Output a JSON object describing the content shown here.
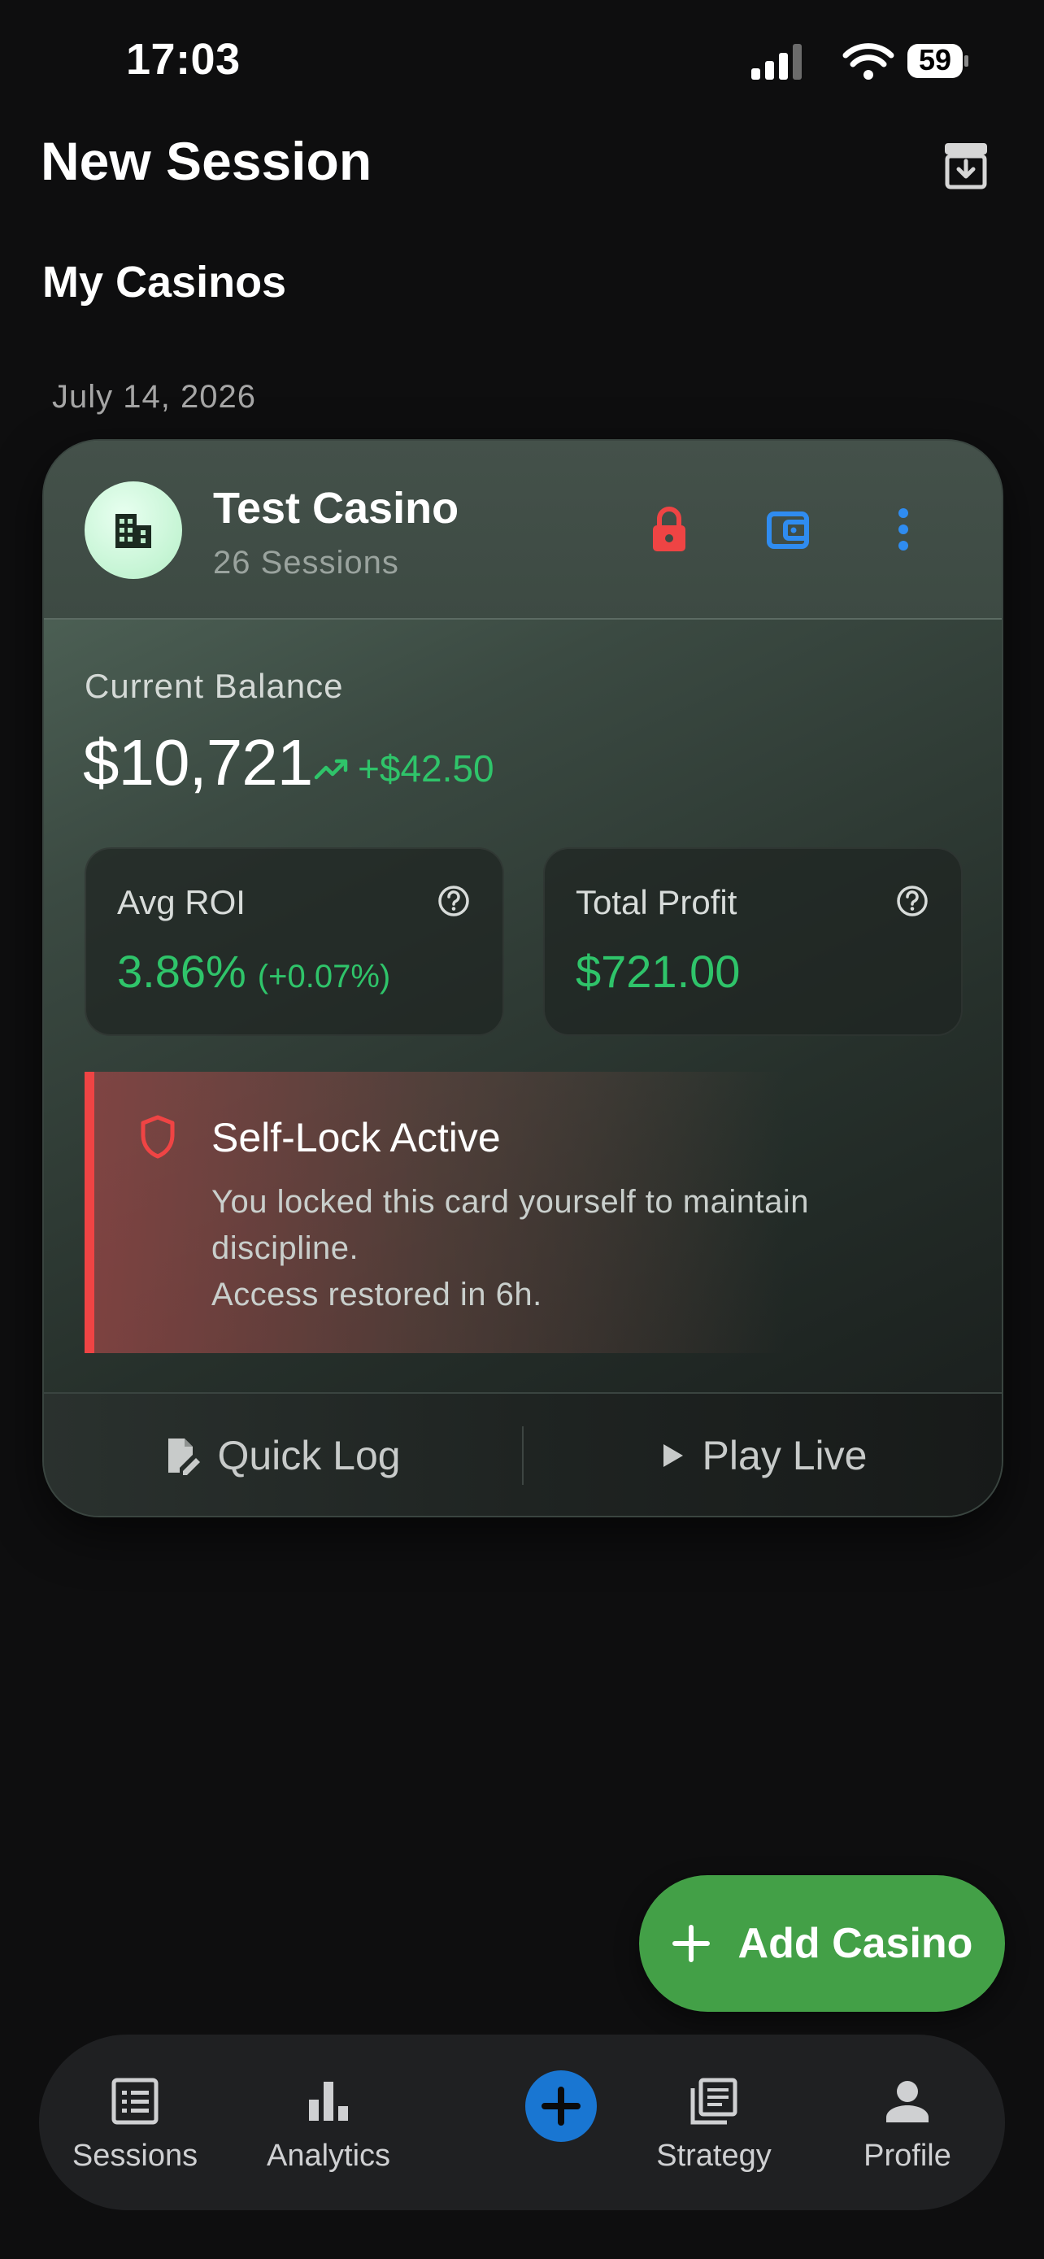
{
  "status_bar": {
    "time": "17:03",
    "battery": "59"
  },
  "header": {
    "title": "New Session"
  },
  "section": {
    "title": "My Casinos"
  },
  "date_label": "July 14, 2026",
  "casino_card": {
    "name": "Test Casino",
    "sessions": "26 Sessions",
    "balance_label": "Current Balance",
    "balance": "$10,721",
    "balance_change": "+$42.50",
    "stats": [
      {
        "label": "Avg ROI",
        "value": "3.86%",
        "sub": "(+0.07%)"
      },
      {
        "label": "Total Profit",
        "value": "$721.00",
        "sub": ""
      }
    ],
    "lock": {
      "title": "Self-Lock Active",
      "message": "You locked this card yourself to maintain discipline.",
      "restore": "Access restored in 6h."
    },
    "actions": {
      "quick_log": "Quick Log",
      "play_live": "Play Live"
    }
  },
  "fab": {
    "label": "Add Casino"
  },
  "bottom_nav": {
    "items": [
      {
        "label": "Sessions",
        "icon": "list-icon"
      },
      {
        "label": "Analytics",
        "icon": "bar-chart-icon"
      },
      {
        "label": "",
        "icon": "plus-icon"
      },
      {
        "label": "Strategy",
        "icon": "library-icon"
      },
      {
        "label": "Profile",
        "icon": "person-icon"
      }
    ]
  },
  "colors": {
    "background": "#0e0e0f",
    "accent_green": "#2fc46a",
    "fab_green": "#43a047",
    "lock_red": "#ef4444",
    "primary_blue": "#1976d2",
    "wallet_blue": "#2f8cf0"
  }
}
